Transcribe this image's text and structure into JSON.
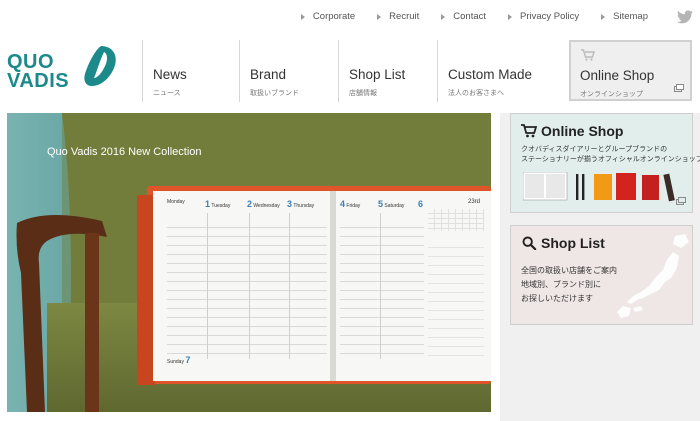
{
  "top_links": [
    "Corporate",
    "Recruit",
    "Contact",
    "Privacy Policy",
    "Sitemap"
  ],
  "logo": {
    "line1": "QUO",
    "line2": "VADIS"
  },
  "nav": [
    {
      "en": "News",
      "ja": "ニュース"
    },
    {
      "en": "Brand",
      "ja": "取扱いブランド"
    },
    {
      "en": "Shop List",
      "ja": "店舗情報"
    },
    {
      "en": "Custom Made",
      "ja": "法人のお客さまへ"
    }
  ],
  "online_shop_button": {
    "en": "Online Shop",
    "ja": "オンラインショップ"
  },
  "hero": {
    "caption": "Quo Vadis 2016 New Collection",
    "planner_days": [
      "Monday",
      "Tuesday",
      "Wednesday",
      "Thursday",
      "Friday",
      "Saturday"
    ],
    "planner_day_numbers": [
      "1",
      "2",
      "3",
      "4",
      "5",
      "6"
    ],
    "planner_sunday": "Sunday",
    "planner_sunday_number": "7",
    "planner_week_number": "23rd"
  },
  "side_cards": {
    "online": {
      "title": "Online Shop",
      "desc_line1": "クオバディスダイアリーとグループブランドの",
      "desc_line2": "ステーショナリーが揃うオフィシャルオンラインショップ"
    },
    "shoplist": {
      "title": "Shop List",
      "desc_line1": "全国の取扱い店舗をご案内",
      "desc_line2": "地域別、ブランド別に",
      "desc_line3": "お探しいただけます"
    }
  },
  "colors": {
    "brand_teal": "#1c8a8a",
    "planner_cover": "#e0542a",
    "planner_accent": "#3a7fb8"
  }
}
